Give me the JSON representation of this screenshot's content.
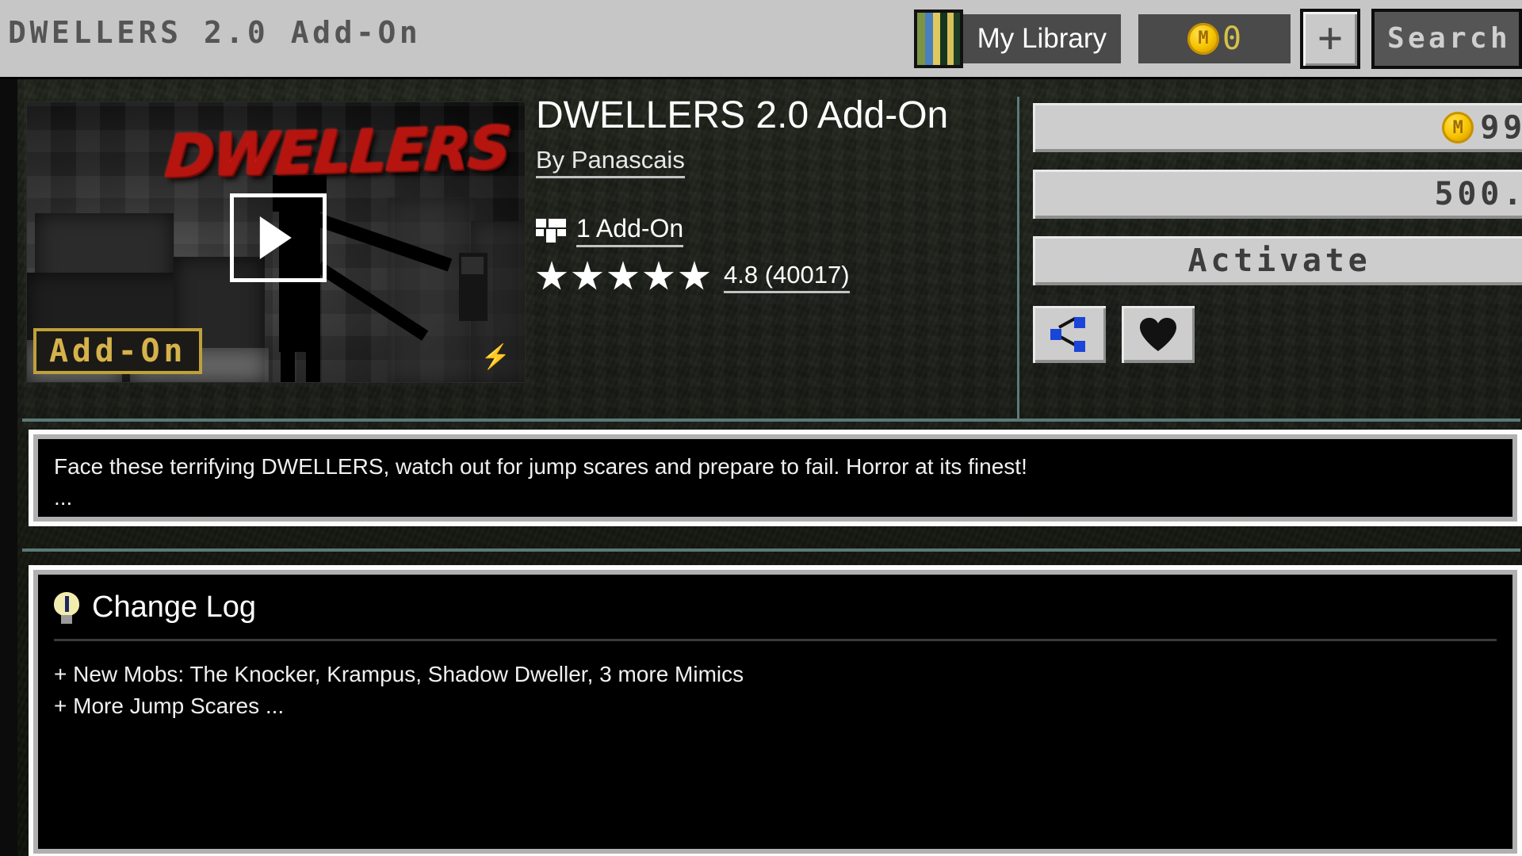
{
  "header": {
    "app_title": "DWELLERS 2.0 Add-On",
    "library_label": "My Library",
    "library_icon": "bookshelf-icon",
    "coin_icon": "minecoin-icon",
    "coin_balance": "0",
    "add_button_label": "+",
    "search_placeholder": "Search",
    "background_color": "#c6c6c6"
  },
  "thumbnail": {
    "logo_text": "DWELLERS",
    "badge_label": "Add-On",
    "badge_color": "#d6b24c",
    "play_icon": "play-triangle-icon",
    "bolt_icon": "lightning-bolt-icon"
  },
  "item": {
    "title": "DWELLERS 2.0 Add-On",
    "author": "By Panascais",
    "addon_count": "1 Add-On",
    "addon_icon": "puzzle-piece-icon",
    "rating_stars": 5,
    "rating_text": "4.8 (40017)"
  },
  "purchase": {
    "coin_icon": "minecoin-icon",
    "price": "99",
    "secondary_price": "500.",
    "activate_label": "Activate",
    "share_icon": "share-nodes-icon",
    "favorite_icon": "heart-icon"
  },
  "description": {
    "line1": "Face these terrifying DWELLERS, watch out for jump scares and prepare to fail. Horror at its finest!",
    "line2": "..."
  },
  "changelog": {
    "icon": "lightbulb-info-icon",
    "title": "Change Log",
    "line1": "+ New Mobs: The Knocker, Krampus, Shadow Dweller, 3 more Mimics",
    "line2": "+ More Jump Scares ..."
  },
  "colors": {
    "panel_border": "#fdfdfd",
    "teal_divider": "#5b7a78",
    "button_face": "#cdcdcd",
    "accent_red": "#b5140f"
  }
}
